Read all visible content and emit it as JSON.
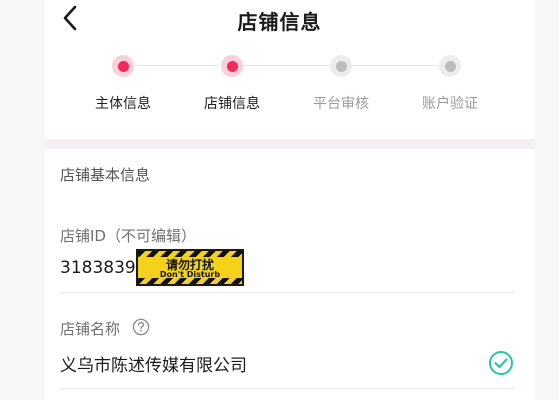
{
  "header": {
    "title": "店铺信息",
    "back_icon": "chevron-left-icon"
  },
  "steps": [
    {
      "label": "主体信息",
      "state": "active"
    },
    {
      "label": "店铺信息",
      "state": "active"
    },
    {
      "label": "平台审核",
      "state": "inactive"
    },
    {
      "label": "账户验证",
      "state": "inactive"
    }
  ],
  "section": {
    "title": "店铺基本信息"
  },
  "store_id": {
    "label": "店铺ID（不可编辑）",
    "value": "3183839"
  },
  "sticker": {
    "title": "请勿打扰",
    "subtitle": "Don't Disturb"
  },
  "store_name": {
    "label": "店铺名称",
    "value": "义乌市陈述传媒有限公司",
    "help_icon": "question-circle-icon",
    "status_icon": "check-circle-icon"
  },
  "colors": {
    "accent": "#f2295b",
    "accent_ring": "#fbd0da",
    "inactive_dot": "#bdbdbd",
    "success": "#2bc4a0",
    "sticker_yellow": "#f4d21c"
  }
}
